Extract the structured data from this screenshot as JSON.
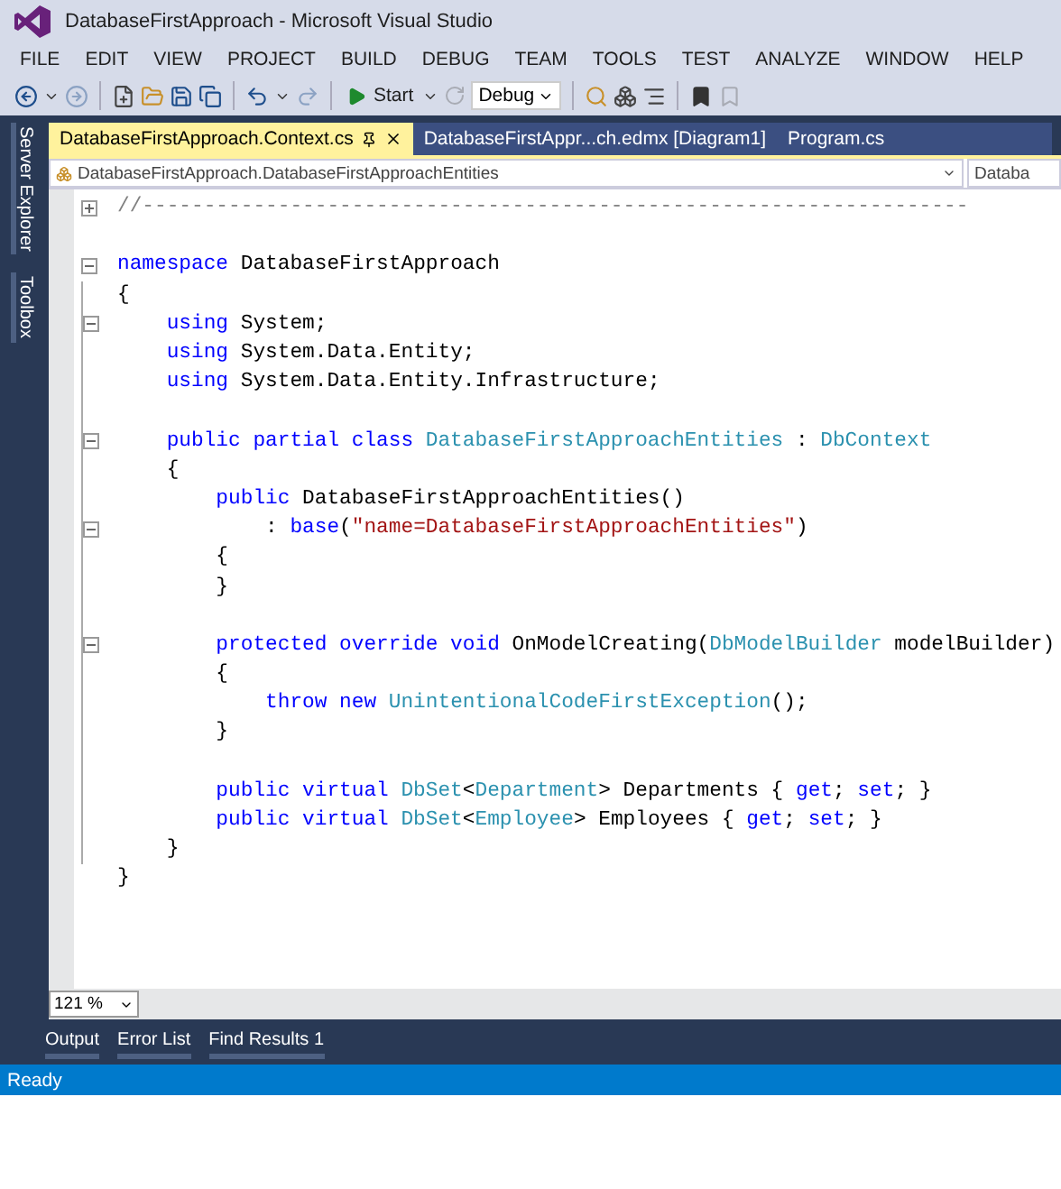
{
  "window": {
    "title": "DatabaseFirstApproach - Microsoft Visual Studio"
  },
  "menu": [
    "FILE",
    "EDIT",
    "VIEW",
    "PROJECT",
    "BUILD",
    "DEBUG",
    "TEAM",
    "TOOLS",
    "TEST",
    "ANALYZE",
    "WINDOW",
    "HELP"
  ],
  "toolbar": {
    "start_label": "Start",
    "configuration": "Debug"
  },
  "side_panels": [
    "Server Explorer",
    "Toolbox"
  ],
  "tabs": [
    {
      "label": "DatabaseFirstApproach.Context.cs",
      "selected": true
    },
    {
      "label": "DatabaseFirstAppr...ch.edmx [Diagram1]",
      "selected": false
    },
    {
      "label": "Program.cs",
      "selected": false
    }
  ],
  "navigation": {
    "type_dropdown": "DatabaseFirstApproach.DatabaseFirstApproachEntities",
    "member_dropdown": "Databa"
  },
  "code_lines": [
    {
      "kind": "collapsed",
      "tokens": [
        {
          "kind": "comment",
          "text": "//-------------------------------------------------------------------"
        }
      ]
    },
    {
      "kind": "plain"
    },
    {
      "kind": "expanded",
      "tokens": [
        {
          "kind": "keyword",
          "text": "namespace"
        },
        {
          "kind": "plain",
          "text": " DatabaseFirstApproach"
        }
      ]
    },
    {
      "kind": "plain",
      "tokens": [
        {
          "kind": "plain",
          "text": "{"
        }
      ]
    },
    {
      "kind": "expanded",
      "tokens": [
        {
          "kind": "keyword",
          "text": "    using"
        },
        {
          "kind": "plain",
          "text": " System;"
        }
      ]
    },
    {
      "kind": "plain",
      "tokens": [
        {
          "kind": "keyword",
          "text": "    using"
        },
        {
          "kind": "plain",
          "text": " System.Data.Entity;"
        }
      ]
    },
    {
      "kind": "plain",
      "tokens": [
        {
          "kind": "keyword",
          "text": "    using"
        },
        {
          "kind": "plain",
          "text": " System.Data.Entity.Infrastructure;"
        }
      ]
    },
    {
      "kind": "plain"
    },
    {
      "kind": "expanded",
      "tokens": [
        {
          "kind": "keyword",
          "text": "    public partial class "
        },
        {
          "kind": "type",
          "text": "DatabaseFirstApproachEntities"
        },
        {
          "kind": "plain",
          "text": " : "
        },
        {
          "kind": "type",
          "text": "DbContext"
        }
      ]
    },
    {
      "kind": "plain",
      "tokens": [
        {
          "kind": "plain",
          "text": "    {"
        }
      ]
    },
    {
      "kind": "plain",
      "tokens": [
        {
          "kind": "keyword",
          "text": "        public"
        },
        {
          "kind": "plain",
          "text": " DatabaseFirstApproachEntities()"
        }
      ]
    },
    {
      "kind": "expanded",
      "tokens": [
        {
          "kind": "plain",
          "text": "            : "
        },
        {
          "kind": "keyword",
          "text": "base"
        },
        {
          "kind": "plain",
          "text": "("
        },
        {
          "kind": "string",
          "text": "\"name=DatabaseFirstApproachEntities\""
        },
        {
          "kind": "plain",
          "text": ")"
        }
      ]
    },
    {
      "kind": "plain",
      "tokens": [
        {
          "kind": "plain",
          "text": "        {"
        }
      ]
    },
    {
      "kind": "plain",
      "tokens": [
        {
          "kind": "plain",
          "text": "        }"
        }
      ]
    },
    {
      "kind": "plain"
    },
    {
      "kind": "expanded",
      "tokens": [
        {
          "kind": "keyword",
          "text": "        protected override void"
        },
        {
          "kind": "plain",
          "text": " OnModelCreating("
        },
        {
          "kind": "type",
          "text": "DbModelBuilder"
        },
        {
          "kind": "plain",
          "text": " modelBuilder)"
        }
      ]
    },
    {
      "kind": "plain",
      "tokens": [
        {
          "kind": "plain",
          "text": "        {"
        }
      ]
    },
    {
      "kind": "plain",
      "tokens": [
        {
          "kind": "keyword",
          "text": "            throw new "
        },
        {
          "kind": "type",
          "text": "UnintentionalCodeFirstException"
        },
        {
          "kind": "plain",
          "text": "();"
        }
      ]
    },
    {
      "kind": "plain",
      "tokens": [
        {
          "kind": "plain",
          "text": "        }"
        }
      ]
    },
    {
      "kind": "plain"
    },
    {
      "kind": "plain",
      "tokens": [
        {
          "kind": "keyword",
          "text": "        public virtual "
        },
        {
          "kind": "type",
          "text": "DbSet"
        },
        {
          "kind": "plain",
          "text": "<"
        },
        {
          "kind": "type",
          "text": "Department"
        },
        {
          "kind": "plain",
          "text": "> Departments { "
        },
        {
          "kind": "keyword",
          "text": "get"
        },
        {
          "kind": "plain",
          "text": "; "
        },
        {
          "kind": "keyword",
          "text": "set"
        },
        {
          "kind": "plain",
          "text": "; }"
        }
      ]
    },
    {
      "kind": "plain",
      "tokens": [
        {
          "kind": "keyword",
          "text": "        public virtual "
        },
        {
          "kind": "type",
          "text": "DbSet"
        },
        {
          "kind": "plain",
          "text": "<"
        },
        {
          "kind": "type",
          "text": "Employee"
        },
        {
          "kind": "plain",
          "text": "> Employees { "
        },
        {
          "kind": "keyword",
          "text": "get"
        },
        {
          "kind": "plain",
          "text": "; "
        },
        {
          "kind": "keyword",
          "text": "set"
        },
        {
          "kind": "plain",
          "text": "; }"
        }
      ]
    },
    {
      "kind": "plain",
      "tokens": [
        {
          "kind": "plain",
          "text": "    }"
        }
      ]
    },
    {
      "kind": "plain",
      "tokens": [
        {
          "kind": "plain",
          "text": "}"
        }
      ]
    }
  ],
  "zoom": "121 %",
  "bottom_tabs": [
    "Output",
    "Error List",
    "Find Results 1"
  ],
  "status_bar": "Ready"
}
